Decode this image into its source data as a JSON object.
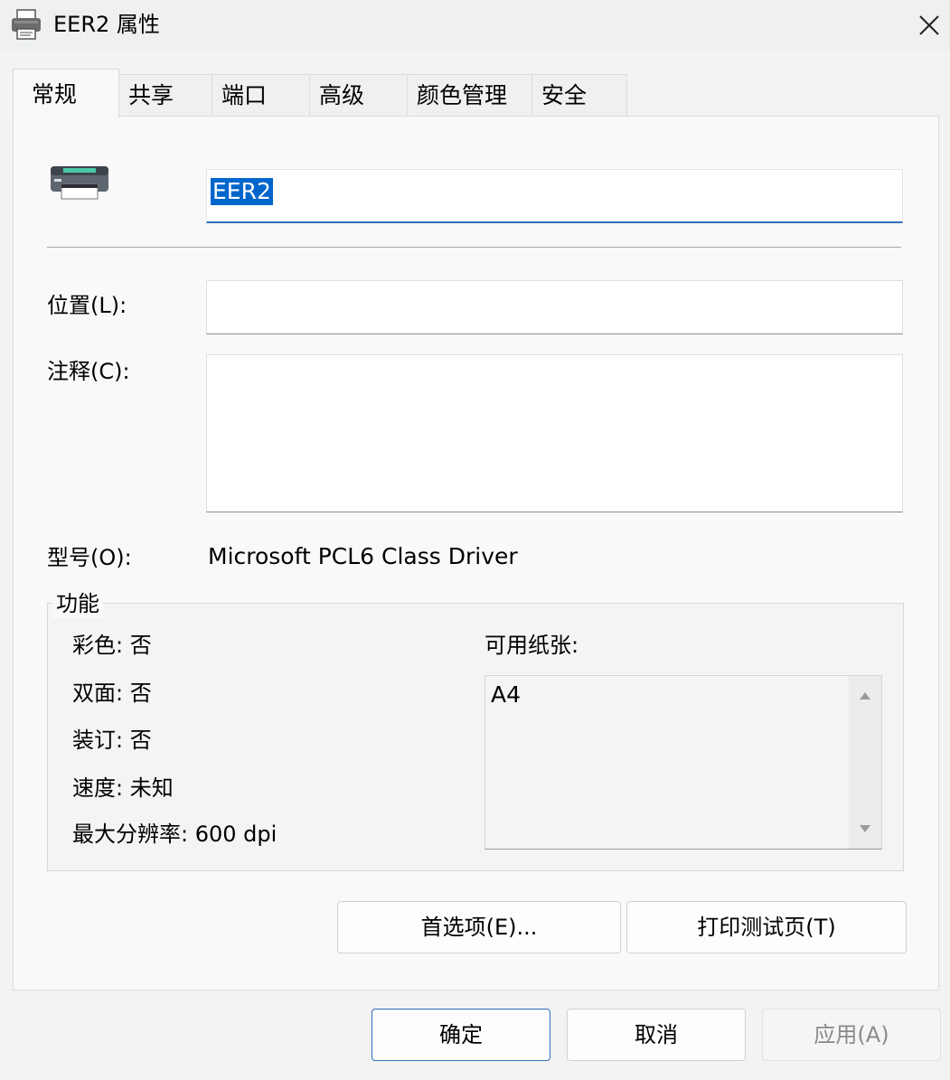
{
  "window": {
    "title": "EER2 属性",
    "icon": "printer-icon",
    "close_icon": "close-icon"
  },
  "tabs": [
    {
      "label": "常规",
      "active": true
    },
    {
      "label": "共享"
    },
    {
      "label": "端口"
    },
    {
      "label": "高级"
    },
    {
      "label": "颜色管理"
    },
    {
      "label": "安全"
    }
  ],
  "general": {
    "printer_name": "EER2",
    "location_label": "位置(L):",
    "location_value": "",
    "comment_label": "注释(C):",
    "comment_value": "",
    "model_label": "型号(O):",
    "model_value": "Microsoft PCL6 Class Driver"
  },
  "features": {
    "group_title": "功能",
    "color": "彩色: 否",
    "duplex": "双面: 否",
    "staple": "装订: 否",
    "speed": "速度: 未知",
    "max_resolution": "最大分辨率: 600 dpi",
    "paper_label": "可用纸张:",
    "paper_list": [
      "A4"
    ]
  },
  "actions": {
    "preferences": "首选项(E)...",
    "print_test_page": "打印测试页(T)"
  },
  "footer": {
    "ok": "确定",
    "cancel": "取消",
    "apply": "应用(A)"
  },
  "colors": {
    "accent": "#2f6fb8",
    "selection": "#0066cc"
  }
}
